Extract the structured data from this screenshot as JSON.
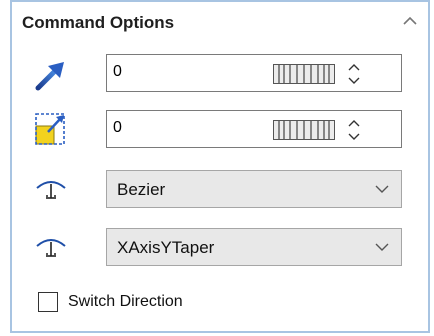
{
  "panel": {
    "title": "Command Options",
    "collapse_icon": "chevron-up-icon"
  },
  "fields": {
    "vector": {
      "icon": "direction-arrow-icon",
      "value": "0"
    },
    "scale": {
      "icon": "scale-box-icon",
      "value": "0"
    }
  },
  "dropdowns": {
    "curve_type": {
      "icon": "taper-profile-icon",
      "value": "Bezier"
    },
    "taper_axis": {
      "icon": "taper-profile-icon",
      "value": "XAxisYTaper"
    }
  },
  "switch_direction": {
    "label": "Switch Direction",
    "checked": false
  }
}
